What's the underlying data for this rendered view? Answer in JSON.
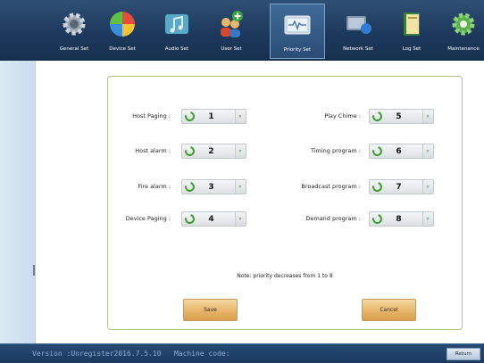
{
  "toolbar": {
    "items": [
      {
        "label": "General Set",
        "icon": "gear-icon"
      },
      {
        "label": "Device Set",
        "icon": "pie-chart-icon"
      },
      {
        "label": "Audio Set",
        "icon": "music-note-icon"
      },
      {
        "label": "User Set",
        "icon": "users-add-icon"
      },
      {
        "label": "Priority Set",
        "icon": "monitor-wave-icon",
        "active": true
      },
      {
        "label": "Network Set",
        "icon": "network-monitor-icon"
      },
      {
        "label": "Log Set",
        "icon": "log-book-icon"
      },
      {
        "label": "Maintenance",
        "icon": "settings-cog-icon"
      }
    ]
  },
  "priority": {
    "left": [
      {
        "label": "Host Paging :",
        "value": "1"
      },
      {
        "label": "Host alarm :",
        "value": "2"
      },
      {
        "label": "Fire alarm :",
        "value": "3"
      },
      {
        "label": "Device Paging :",
        "value": "4"
      }
    ],
    "right": [
      {
        "label": "Play Chime :",
        "value": "5"
      },
      {
        "label": "Timing program :",
        "value": "6"
      },
      {
        "label": "Broadcast program :",
        "value": "7"
      },
      {
        "label": "Demand program :",
        "value": "8"
      }
    ],
    "note": "Note:  priority decreases from 1 to 8",
    "save_label": "Save",
    "cancel_label": "Cancel"
  },
  "status": {
    "text": "Version :Unregister2016.7.5.10   Machine code:",
    "return_label": "Return"
  },
  "colors": {
    "toolbar_bg": "#1d3a5d",
    "panel_border": "#a8c98a",
    "button_orange": "#e6b267",
    "status_bg": "#1b3b60",
    "selector_icon": "#3a9d2f"
  }
}
